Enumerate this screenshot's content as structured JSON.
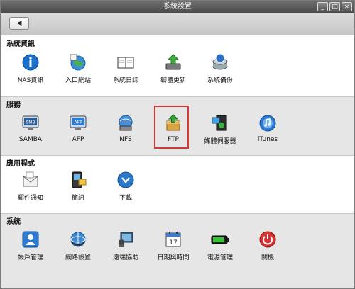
{
  "window": {
    "title": "系統設置",
    "controls": [
      "_",
      "□",
      "×"
    ]
  },
  "toolbar": {
    "back_label": "◀"
  },
  "sections": [
    {
      "title": "系統資訊",
      "items": [
        {
          "label": "NAS資訊",
          "icon": "info-icon"
        },
        {
          "label": "入口網站",
          "icon": "portal-icon"
        },
        {
          "label": "系統日誌",
          "icon": "log-book-icon"
        },
        {
          "label": "韌體更新",
          "icon": "firmware-update-icon"
        },
        {
          "label": "系統備份",
          "icon": "backup-icon"
        }
      ]
    },
    {
      "title": "服務",
      "items": [
        {
          "label": "SAMBA",
          "icon": "samba-icon"
        },
        {
          "label": "AFP",
          "icon": "afp-icon"
        },
        {
          "label": "NFS",
          "icon": "nfs-icon"
        },
        {
          "label": "FTP",
          "icon": "ftp-icon"
        },
        {
          "label": "媒體伺服器",
          "icon": "media-server-icon"
        },
        {
          "label": "iTunes",
          "icon": "itunes-icon"
        }
      ]
    },
    {
      "title": "應用程式",
      "items": [
        {
          "label": "郵件通知",
          "icon": "mail-icon"
        },
        {
          "label": "簡訊",
          "icon": "sms-icon"
        },
        {
          "label": "下載",
          "icon": "download-icon"
        }
      ]
    },
    {
      "title": "系統",
      "items": [
        {
          "label": "帳戶管理",
          "icon": "account-icon"
        },
        {
          "label": "網路設置",
          "icon": "network-icon"
        },
        {
          "label": "遠端協助",
          "icon": "remote-assist-icon"
        },
        {
          "label": "日期與時間",
          "icon": "calendar-icon"
        },
        {
          "label": "電源管理",
          "icon": "battery-icon"
        },
        {
          "label": "關機",
          "icon": "power-icon"
        }
      ]
    }
  ],
  "calendar_day": "17",
  "accent_highlight": "#d23a3a"
}
